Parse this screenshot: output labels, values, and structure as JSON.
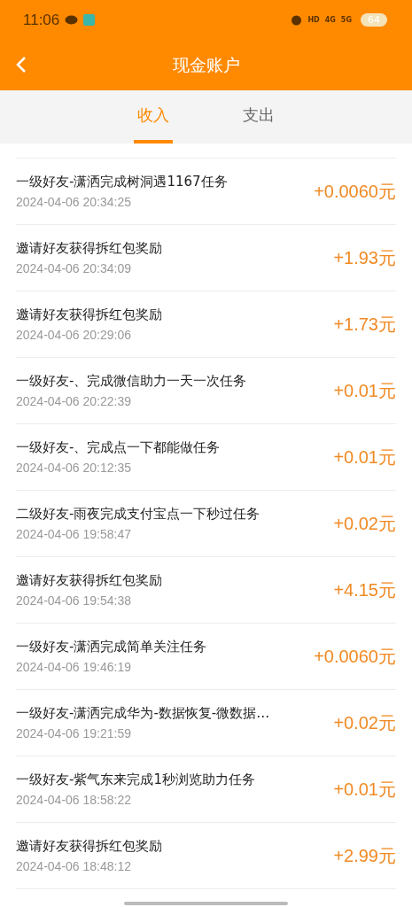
{
  "status_bar": {
    "time": "11:06",
    "network_labels": [
      "HD",
      "4G",
      "5G"
    ],
    "battery": "64"
  },
  "header": {
    "title": "现金账户"
  },
  "tabs": [
    {
      "label": "收入",
      "selected": true
    },
    {
      "label": "支出",
      "selected": false
    }
  ],
  "records": [
    {
      "title": "一级好友-潇洒完成树洞遇1167任务",
      "time": "2024-04-06 20:34:25",
      "amount": "+0.0060元"
    },
    {
      "title": "邀请好友获得拆红包奖励",
      "time": "2024-04-06 20:34:09",
      "amount": "+1.93元"
    },
    {
      "title": "邀请好友获得拆红包奖励",
      "time": "2024-04-06 20:29:06",
      "amount": "+1.73元"
    },
    {
      "title": "一级好友-、完成微信助力一天一次任务",
      "time": "2024-04-06 20:22:39",
      "amount": "+0.01元"
    },
    {
      "title": "一级好友-、完成点一下都能做任务",
      "time": "2024-04-06 20:12:35",
      "amount": "+0.01元"
    },
    {
      "title": "二级好友-雨夜完成支付宝点一下秒过任务",
      "time": "2024-04-06 19:58:47",
      "amount": "+0.02元"
    },
    {
      "title": "邀请好友获得拆红包奖励",
      "time": "2024-04-06 19:54:38",
      "amount": "+4.15元"
    },
    {
      "title": "一级好友-潇洒完成简单关注任务",
      "time": "2024-04-06 19:46:19",
      "amount": "+0.0060元"
    },
    {
      "title": "一级好友-潇洒完成华为-数据恢复-微数据…",
      "time": "2024-04-06 19:21:59",
      "amount": "+0.02元"
    },
    {
      "title": "一级好友-紫气东来完成1秒浏览助力任务",
      "time": "2024-04-06 18:58:22",
      "amount": "+0.01元"
    },
    {
      "title": "邀请好友获得拆红包奖励",
      "time": "2024-04-06 18:48:12",
      "amount": "+2.99元"
    }
  ]
}
